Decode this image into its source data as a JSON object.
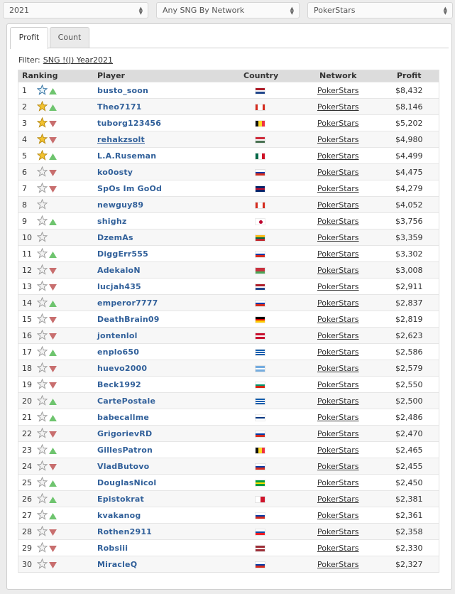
{
  "filters": {
    "year": "2021",
    "type": "Any SNG By Network",
    "network": "PokerStars"
  },
  "tabs": [
    {
      "label": "Profit",
      "active": true
    },
    {
      "label": "Count",
      "active": false
    }
  ],
  "filter_line": {
    "label": "Filter:",
    "value": "SNG !(J) Year2021"
  },
  "columns": {
    "ranking": "Ranking",
    "player": "Player",
    "country": "Country",
    "network": "Network",
    "profit": "Profit"
  },
  "colors": {
    "link": "#31609a",
    "trend_up": "#6ec46e",
    "trend_down": "#c86e6e",
    "star_gold": "#f2c230"
  },
  "rows": [
    {
      "rank": "1",
      "player": "busto_soon",
      "star": "blue-outline",
      "trend": "up",
      "flag": "netherlands",
      "network": "PokerStars",
      "profit": "$8,432"
    },
    {
      "rank": "2",
      "player": "Theo7171",
      "star": "gold",
      "trend": "up",
      "flag": "canada",
      "network": "PokerStars",
      "profit": "$8,146"
    },
    {
      "rank": "3",
      "player": "tuborg123456",
      "star": "gold",
      "trend": "down",
      "flag": "belgium",
      "network": "PokerStars",
      "profit": "$5,202"
    },
    {
      "rank": "4",
      "player": "rehakzsolt",
      "star": "gold",
      "trend": "down",
      "flag": "hungary",
      "network": "PokerStars",
      "profit": "$4,980"
    },
    {
      "rank": "5",
      "player": "L.A.Ruseman",
      "star": "gold",
      "trend": "up",
      "flag": "mexico",
      "network": "PokerStars",
      "profit": "$4,499"
    },
    {
      "rank": "6",
      "player": "ko0osty",
      "star": "gray",
      "trend": "down",
      "flag": "russia",
      "network": "PokerStars",
      "profit": "$4,475"
    },
    {
      "rank": "7",
      "player": "SpOs Im GoOd",
      "star": "gray",
      "trend": "down",
      "flag": "uk",
      "network": "PokerStars",
      "profit": "$4,279"
    },
    {
      "rank": "8",
      "player": "newguy89",
      "star": "gray",
      "trend": "none",
      "flag": "canada",
      "network": "PokerStars",
      "profit": "$4,052"
    },
    {
      "rank": "9",
      "player": "shighz",
      "star": "gray",
      "trend": "up",
      "flag": "japan",
      "network": "PokerStars",
      "profit": "$3,756"
    },
    {
      "rank": "10",
      "player": "DzemAs",
      "star": "gray",
      "trend": "none",
      "flag": "lithuania",
      "network": "PokerStars",
      "profit": "$3,359"
    },
    {
      "rank": "11",
      "player": "DiggErr555",
      "star": "gray",
      "trend": "up",
      "flag": "russia",
      "network": "PokerStars",
      "profit": "$3,302"
    },
    {
      "rank": "12",
      "player": "AdekaloN",
      "star": "gray",
      "trend": "down",
      "flag": "belarus",
      "network": "PokerStars",
      "profit": "$3,008"
    },
    {
      "rank": "13",
      "player": "lucjah435",
      "star": "gray",
      "trend": "down",
      "flag": "netherlands",
      "network": "PokerStars",
      "profit": "$2,911"
    },
    {
      "rank": "14",
      "player": "emperor7777",
      "star": "gray",
      "trend": "up",
      "flag": "russia",
      "network": "PokerStars",
      "profit": "$2,837"
    },
    {
      "rank": "15",
      "player": "DeathBrain09",
      "star": "gray",
      "trend": "down",
      "flag": "germany",
      "network": "PokerStars",
      "profit": "$2,819"
    },
    {
      "rank": "16",
      "player": "jontenlol",
      "star": "gray",
      "trend": "down",
      "flag": "denmark",
      "network": "PokerStars",
      "profit": "$2,623"
    },
    {
      "rank": "17",
      "player": "enplo650",
      "star": "gray",
      "trend": "up",
      "flag": "greece",
      "network": "PokerStars",
      "profit": "$2,586"
    },
    {
      "rank": "18",
      "player": "huevo2000",
      "star": "gray",
      "trend": "down",
      "flag": "argentina",
      "network": "PokerStars",
      "profit": "$2,579"
    },
    {
      "rank": "19",
      "player": "Beck1992",
      "star": "gray",
      "trend": "down",
      "flag": "bulgaria",
      "network": "PokerStars",
      "profit": "$2,550"
    },
    {
      "rank": "20",
      "player": "CartePostale",
      "star": "gray",
      "trend": "up",
      "flag": "greece",
      "network": "PokerStars",
      "profit": "$2,500"
    },
    {
      "rank": "21",
      "player": "babecallme",
      "star": "gray",
      "trend": "up",
      "flag": "finland",
      "network": "PokerStars",
      "profit": "$2,486"
    },
    {
      "rank": "22",
      "player": "GrigorievRD",
      "star": "gray",
      "trend": "down",
      "flag": "russia",
      "network": "PokerStars",
      "profit": "$2,470"
    },
    {
      "rank": "23",
      "player": "GillesPatron",
      "star": "gray",
      "trend": "up",
      "flag": "belgium",
      "network": "PokerStars",
      "profit": "$2,465"
    },
    {
      "rank": "24",
      "player": "VladButovo",
      "star": "gray",
      "trend": "down",
      "flag": "russia",
      "network": "PokerStars",
      "profit": "$2,455"
    },
    {
      "rank": "25",
      "player": "DouglasNicol",
      "star": "gray",
      "trend": "up",
      "flag": "brazil",
      "network": "PokerStars",
      "profit": "$2,450"
    },
    {
      "rank": "26",
      "player": "Epistokrat",
      "star": "gray",
      "trend": "up",
      "flag": "malta",
      "network": "PokerStars",
      "profit": "$2,381"
    },
    {
      "rank": "27",
      "player": "kvakanog",
      "star": "gray",
      "trend": "up",
      "flag": "russia",
      "network": "PokerStars",
      "profit": "$2,361"
    },
    {
      "rank": "28",
      "player": "Rothen2911",
      "star": "gray",
      "trend": "down",
      "flag": "slovakia",
      "network": "PokerStars",
      "profit": "$2,358"
    },
    {
      "rank": "29",
      "player": "Robsiii",
      "star": "gray",
      "trend": "down",
      "flag": "latvia",
      "network": "PokerStars",
      "profit": "$2,330"
    },
    {
      "rank": "30",
      "player": "MiracleQ",
      "star": "gray",
      "trend": "down",
      "flag": "russia",
      "network": "PokerStars",
      "profit": "$2,327"
    }
  ]
}
